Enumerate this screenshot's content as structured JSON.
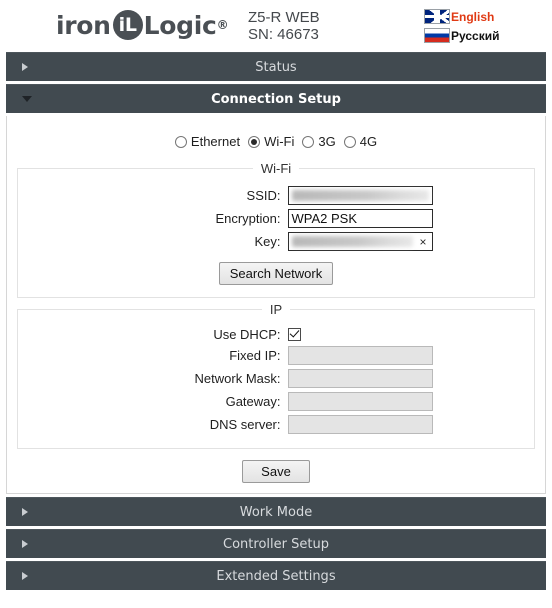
{
  "header": {
    "logo": {
      "text_before": "iron",
      "badge": "iL",
      "text_after": "Logic",
      "registered": "®"
    },
    "device_model": "Z5-R WEB",
    "device_serial": "SN: 46673",
    "languages": [
      {
        "label": "English",
        "flag": "uk-flag-icon",
        "active": true
      },
      {
        "label": "Русский",
        "flag": "russia-flag-icon",
        "active": false
      }
    ]
  },
  "sections": [
    {
      "title": "Status",
      "expanded": false
    },
    {
      "title": "Connection Setup",
      "expanded": true
    },
    {
      "title": "Work Mode",
      "expanded": false
    },
    {
      "title": "Controller Setup",
      "expanded": false
    },
    {
      "title": "Extended Settings",
      "expanded": false
    }
  ],
  "connection_setup": {
    "connection_types": [
      {
        "label": "Ethernet",
        "selected": false
      },
      {
        "label": "Wi-Fi",
        "selected": true
      },
      {
        "label": "3G",
        "selected": false
      },
      {
        "label": "4G",
        "selected": false
      }
    ],
    "wifi": {
      "legend": "Wi-Fi",
      "fields": [
        {
          "label": "SSID:",
          "value": "",
          "redacted": true,
          "disabled": false,
          "clear_button": false
        },
        {
          "label": "Encryption:",
          "value": "WPA2 PSK",
          "redacted": false,
          "disabled": false,
          "clear_button": false
        },
        {
          "label": "Key:",
          "value": "",
          "redacted": true,
          "disabled": false,
          "clear_button": true,
          "clear_label": "×"
        }
      ],
      "search_button": "Search Network"
    },
    "ip": {
      "legend": "IP",
      "dhcp": {
        "label": "Use DHCP:",
        "checked": true
      },
      "fields": [
        {
          "label": "Fixed IP:",
          "value": "",
          "disabled": true
        },
        {
          "label": "Network Mask:",
          "value": "",
          "disabled": true
        },
        {
          "label": "Gateway:",
          "value": "",
          "disabled": true
        },
        {
          "label": "DNS server:",
          "value": "",
          "disabled": true
        }
      ]
    },
    "save_button": "Save"
  },
  "colors": {
    "bar_background": "#414a50",
    "bar_text": "#d7dadd",
    "bar_text_active": "#ffffff",
    "english_label": "#e03a14",
    "logo": "#4a4f54"
  }
}
